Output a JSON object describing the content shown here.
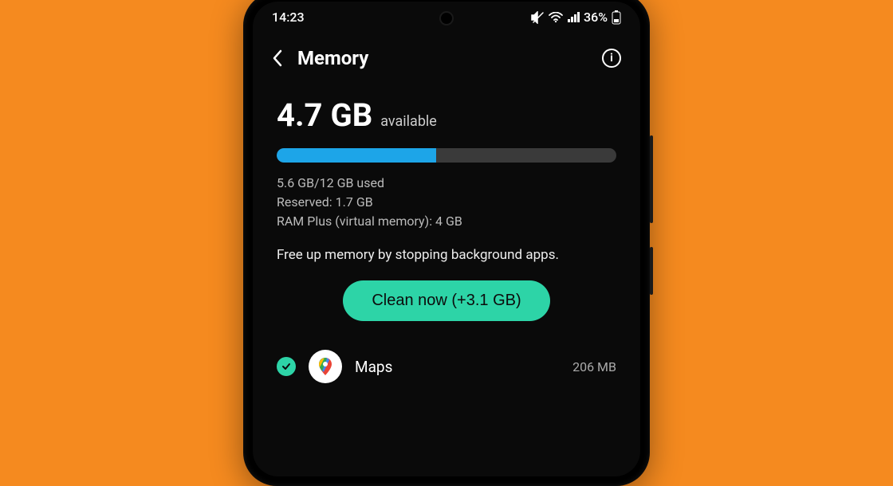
{
  "status": {
    "time": "14:23",
    "battery_text": "36%"
  },
  "header": {
    "title": "Memory"
  },
  "memory": {
    "available_amount": "4.7 GB",
    "available_label": "available",
    "progress_percent": 47,
    "used_line": "5.6 GB/12 GB used",
    "reserved_line": "Reserved: 1.7 GB",
    "ramplus_line": "RAM Plus (virtual memory): 4 GB",
    "hint": "Free up memory by stopping background apps.",
    "clean_label": "Clean now (+3.1 GB)"
  },
  "apps": [
    {
      "name": "Maps",
      "size": "206 MB",
      "checked": true
    }
  ],
  "colors": {
    "accent": "#2dd4a7",
    "progress": "#1da5e8",
    "background": "#f58a1f"
  }
}
